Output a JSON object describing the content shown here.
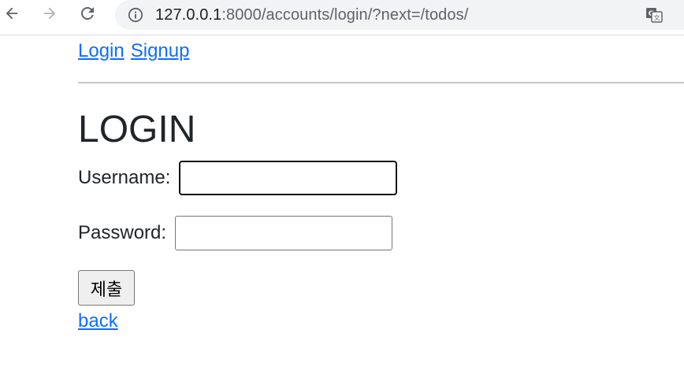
{
  "browser": {
    "url_host": "127.0.0.1",
    "url_path": ":8000/accounts/login/?next=/todos/",
    "icons": [
      "back-arrow-icon",
      "forward-arrow-icon",
      "reload-icon",
      "info-icon",
      "translate-icon"
    ]
  },
  "nav": {
    "login_label": "Login",
    "signup_label": "Signup"
  },
  "login": {
    "title": "LOGIN",
    "username_label": "Username:",
    "username_value": "",
    "password_label": "Password:",
    "password_value": "",
    "submit_label": "제출",
    "back_label": "back"
  },
  "colors": {
    "link": "#0d6efd",
    "text": "#212529",
    "divider": "#c8c8c8"
  }
}
